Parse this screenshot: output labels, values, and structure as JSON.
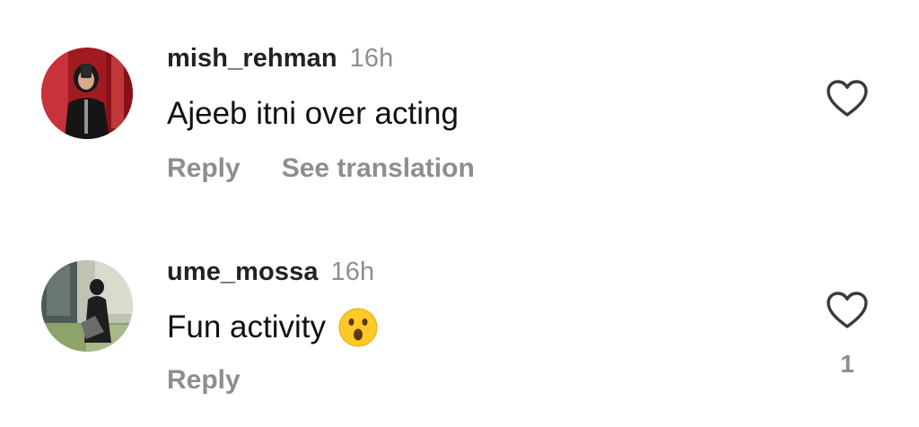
{
  "comments": [
    {
      "username": "mish_rehman",
      "timestamp": "16h",
      "text": "Ajeeb itni over acting",
      "emoji": "",
      "actions": {
        "reply": "Reply",
        "translate": "See translation"
      },
      "likes": "",
      "icons": {
        "like": "heart-outline-icon"
      }
    },
    {
      "username": "ume_mossa",
      "timestamp": "16h",
      "text": "Fun activity",
      "emoji": "astonished-face-emoji",
      "actions": {
        "reply": "Reply"
      },
      "likes": "1",
      "icons": {
        "like": "heart-outline-icon"
      }
    }
  ],
  "colors": {
    "primary_text": "#111111",
    "secondary_text": "#8e8e8e",
    "background": "#ffffff"
  }
}
